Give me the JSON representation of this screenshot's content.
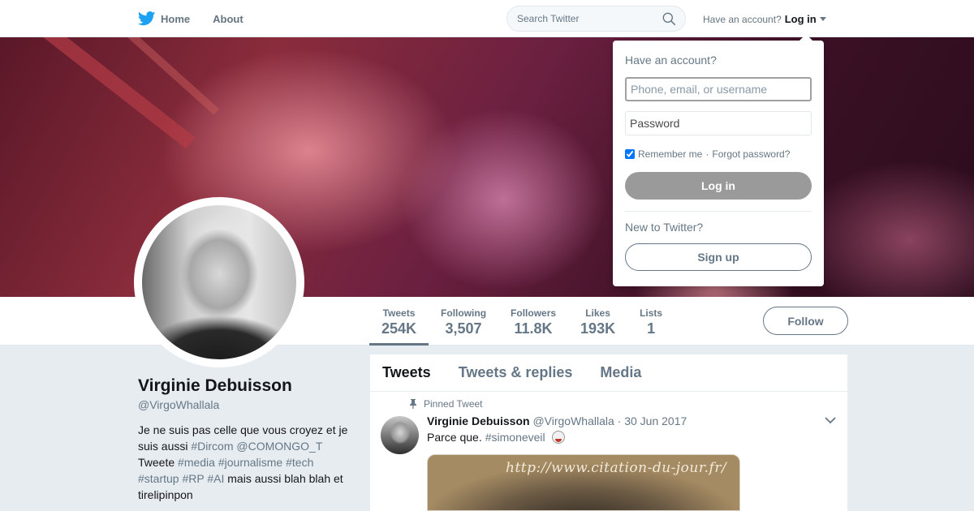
{
  "nav": {
    "home_label": "Home",
    "about_label": "About",
    "search_placeholder": "Search Twitter",
    "account_prompt": "Have an account?",
    "login_label": "Log in",
    "brand_color": "#1da1f2"
  },
  "profile": {
    "name": "Virginie Debuisson",
    "handle": "@VirgoWhallala",
    "bio": {
      "line1": "Je ne suis pas celle que vous croyez et je suis aussi",
      "tag1": "#Dircom",
      "mention": "@COMONGO_T",
      "text2": "Tweete",
      "tag2": "#media",
      "tag3": "#journalisme",
      "tag4": "#tech",
      "tag5": "#startup",
      "tag6": "#RP",
      "tag7": "#AI",
      "text3": "mais aussi blah blah et tirelipinpon"
    }
  },
  "stats": [
    {
      "label": "Tweets",
      "value": "254K"
    },
    {
      "label": "Following",
      "value": "3,507"
    },
    {
      "label": "Followers",
      "value": "11.8K"
    },
    {
      "label": "Likes",
      "value": "193K"
    },
    {
      "label": "Lists",
      "value": "1"
    }
  ],
  "follow_label": "Follow",
  "timeline": {
    "tabs": [
      "Tweets",
      "Tweets & replies",
      "Media"
    ],
    "pinned_label": "Pinned Tweet",
    "tweet": {
      "name": "Virginie Debuisson",
      "handle": "@VirgoWhallala",
      "date": "· 30 Jun 2017",
      "text": "Parce que.",
      "tag": "#simoneveil",
      "media_caption": "http://www.citation-du-jour.fr/"
    }
  },
  "login_dropdown": {
    "title": "Have an account?",
    "username_placeholder": "Phone, email, or username",
    "password_placeholder": "Password",
    "remember_label": "Remember me",
    "separator": "·",
    "forgot_label": "Forgot password?",
    "login_button": "Log in",
    "new_prompt": "New to Twitter?",
    "signup_button": "Sign up"
  }
}
